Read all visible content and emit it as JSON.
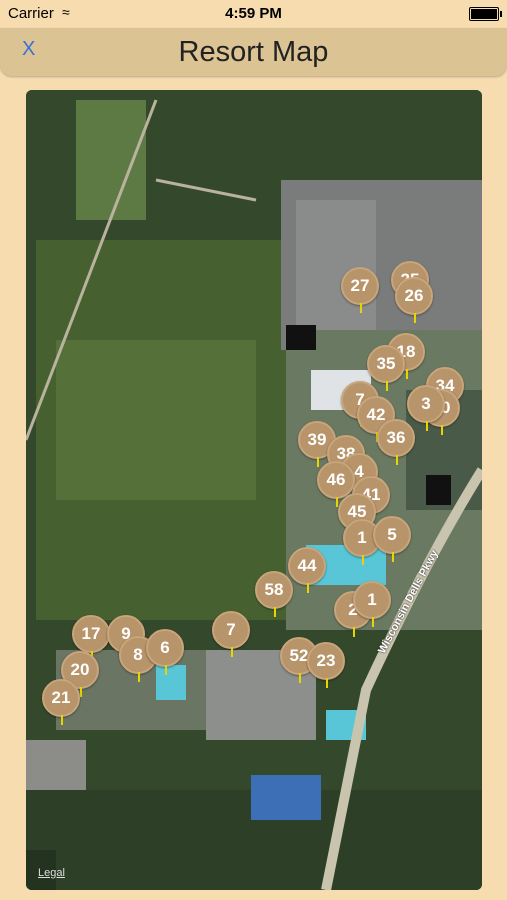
{
  "status_bar": {
    "carrier": "Carrier",
    "time": "4:59 PM"
  },
  "nav": {
    "close_label": "X",
    "title": "Resort Map"
  },
  "map": {
    "road_label": "Wisconsin Dells Pkwy",
    "legal_label": "Legal",
    "pin_color": "#b8946a",
    "pin_stem_color": "#e8d400"
  },
  "pins": [
    "27",
    "25",
    "26",
    "18",
    "35",
    "34",
    "30",
    "3",
    "7",
    "42",
    "36",
    "39",
    "38",
    "4",
    "46",
    "41",
    "45",
    "1",
    "5",
    "44",
    "58",
    "2",
    "1",
    "7",
    "17",
    "9",
    "8",
    "6",
    "20",
    "52",
    "23",
    "21"
  ]
}
